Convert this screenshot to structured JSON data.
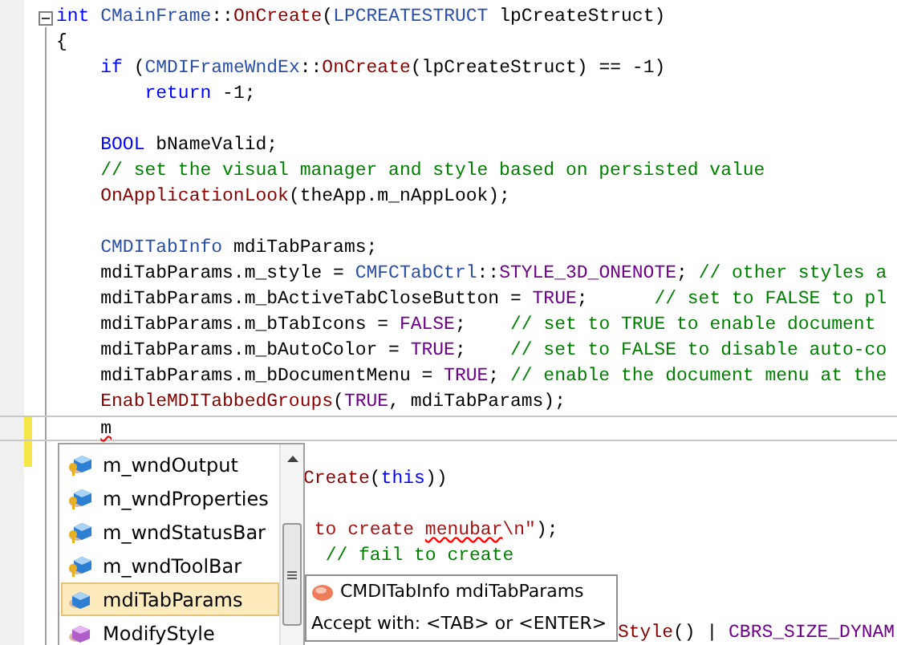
{
  "editor": {
    "lines": [
      {
        "kind": "line",
        "changed": false,
        "current": false,
        "collapsible": true,
        "tokens": [
          {
            "kind": "keyword",
            "text": "int"
          },
          {
            "kind": "type",
            "text": " CMainFrame"
          },
          {
            "kind": "plain",
            "text": "::"
          },
          {
            "kind": "function",
            "text": "OnCreate"
          },
          {
            "kind": "plain",
            "text": "("
          },
          {
            "kind": "type",
            "text": "LPCREATESTRUCT"
          },
          {
            "kind": "plain",
            "text": " lpCreateStruct)"
          }
        ]
      },
      {
        "kind": "line",
        "changed": false,
        "current": false,
        "collapsible": false,
        "tokens": [
          {
            "kind": "plain",
            "text": "{"
          }
        ]
      },
      {
        "kind": "line",
        "changed": false,
        "current": false,
        "collapsible": false,
        "tokens": [
          {
            "kind": "keyword",
            "text": "    if"
          },
          {
            "kind": "plain",
            "text": " ("
          },
          {
            "kind": "type",
            "text": "CMDIFrameWndEx"
          },
          {
            "kind": "plain",
            "text": "::"
          },
          {
            "kind": "function",
            "text": "OnCreate"
          },
          {
            "kind": "plain",
            "text": "(lpCreateStruct) == -1)"
          }
        ]
      },
      {
        "kind": "line",
        "changed": false,
        "current": false,
        "collapsible": false,
        "tokens": [
          {
            "kind": "keyword",
            "text": "        return"
          },
          {
            "kind": "plain",
            "text": " -1;"
          }
        ]
      },
      {
        "kind": "line",
        "changed": false,
        "current": false,
        "collapsible": false
      },
      {
        "kind": "line",
        "changed": false,
        "current": false,
        "collapsible": false,
        "tokens": [
          {
            "kind": "keyword",
            "text": "    BOOL"
          },
          {
            "kind": "plain",
            "text": " bNameValid;"
          }
        ]
      },
      {
        "kind": "line",
        "changed": false,
        "current": false,
        "collapsible": false,
        "tokens": [
          {
            "kind": "comment",
            "text": "    // set the visual manager and style based on persisted value"
          }
        ]
      },
      {
        "kind": "line",
        "changed": false,
        "current": false,
        "collapsible": false,
        "tokens": [
          {
            "kind": "function",
            "text": "    OnApplicationLook"
          },
          {
            "kind": "plain",
            "text": "(theApp.m_nAppLook);"
          }
        ]
      },
      {
        "kind": "line",
        "changed": false,
        "current": false,
        "collapsible": false
      },
      {
        "kind": "line",
        "changed": false,
        "current": false,
        "collapsible": false,
        "tokens": [
          {
            "kind": "type",
            "text": "    CMDITabInfo"
          },
          {
            "kind": "plain",
            "text": " mdiTabParams;"
          }
        ]
      },
      {
        "kind": "line",
        "changed": false,
        "current": false,
        "collapsible": false,
        "tokens": [
          {
            "kind": "plain",
            "text": "    mdiTabParams.m_style = "
          },
          {
            "kind": "type",
            "text": "CMFCTabCtrl"
          },
          {
            "kind": "plain",
            "text": "::"
          },
          {
            "kind": "macro",
            "text": "STYLE_3D_ONENOTE"
          },
          {
            "kind": "plain",
            "text": "; "
          },
          {
            "kind": "comment",
            "text": "// other styles a"
          }
        ]
      },
      {
        "kind": "line",
        "changed": false,
        "current": false,
        "collapsible": false,
        "tokens": [
          {
            "kind": "plain",
            "text": "    mdiTabParams.m_bActiveTabCloseButton = "
          },
          {
            "kind": "macro",
            "text": "TRUE"
          },
          {
            "kind": "plain",
            "text": ";      "
          },
          {
            "kind": "comment",
            "text": "// set to FALSE to pl"
          }
        ]
      },
      {
        "kind": "line",
        "changed": false,
        "current": false,
        "collapsible": false,
        "tokens": [
          {
            "kind": "plain",
            "text": "    mdiTabParams.m_bTabIcons = "
          },
          {
            "kind": "macro",
            "text": "FALSE"
          },
          {
            "kind": "plain",
            "text": ";    "
          },
          {
            "kind": "comment",
            "text": "// set to TRUE to enable document"
          }
        ]
      },
      {
        "kind": "line",
        "changed": false,
        "current": false,
        "collapsible": false,
        "tokens": [
          {
            "kind": "plain",
            "text": "    mdiTabParams.m_bAutoColor = "
          },
          {
            "kind": "macro",
            "text": "TRUE"
          },
          {
            "kind": "plain",
            "text": ";    "
          },
          {
            "kind": "comment",
            "text": "// set to FALSE to disable auto-co"
          }
        ]
      },
      {
        "kind": "line",
        "changed": false,
        "current": false,
        "collapsible": false,
        "tokens": [
          {
            "kind": "plain",
            "text": "    mdiTabParams.m_bDocumentMenu = "
          },
          {
            "kind": "macro",
            "text": "TRUE"
          },
          {
            "kind": "plain",
            "text": "; "
          },
          {
            "kind": "comment",
            "text": "// enable the document menu at the"
          }
        ]
      },
      {
        "kind": "line",
        "changed": false,
        "current": false,
        "collapsible": false,
        "tokens": [
          {
            "kind": "function",
            "text": "    EnableMDITabbedGroups"
          },
          {
            "kind": "plain",
            "text": "("
          },
          {
            "kind": "macro",
            "text": "TRUE"
          },
          {
            "kind": "plain",
            "text": ", mdiTabParams);"
          }
        ]
      },
      {
        "kind": "line",
        "changed": true,
        "current": true,
        "collapsible": false,
        "tokens": [
          {
            "kind": "error",
            "text": "    m"
          }
        ]
      },
      {
        "kind": "line",
        "changed": true,
        "current": false,
        "collapsible": false
      },
      {
        "kind": "after_list",
        "changed": false,
        "current": false,
        "collapsible": false,
        "tokens": [
          {
            "kind": "function",
            "text": "Create"
          },
          {
            "kind": "plain",
            "text": "("
          },
          {
            "kind": "keyword",
            "text": "this"
          },
          {
            "kind": "plain",
            "text": "))"
          }
        ]
      },
      {
        "kind": "line",
        "changed": false,
        "current": false,
        "collapsible": false
      },
      {
        "kind": "after_list",
        "changed": false,
        "current": false,
        "collapsible": false,
        "tokens": [
          {
            "kind": "string",
            "text": " to create "
          },
          {
            "kind": "string_error",
            "text": "menubar"
          },
          {
            "kind": "string",
            "text": "\\n\""
          },
          {
            "kind": "plain",
            "text": ");"
          }
        ]
      },
      {
        "kind": "after_list",
        "changed": false,
        "current": false,
        "collapsible": false,
        "tokens": [
          {
            "kind": "comment",
            "text": "  // fail to create"
          }
        ]
      },
      {
        "kind": "line",
        "changed": false,
        "current": false,
        "collapsible": false
      },
      {
        "kind": "line",
        "changed": false,
        "current": false,
        "collapsible": false
      },
      {
        "kind": "after_tip",
        "changed": false,
        "current": false,
        "collapsible": false,
        "tokens": [
          {
            "kind": "function",
            "text": "Style"
          },
          {
            "kind": "plain",
            "text": "() | "
          },
          {
            "kind": "macro",
            "text": "CBRS_SIZE_DYNAM"
          }
        ]
      }
    ]
  },
  "completion": {
    "items": [
      {
        "label": "m_wndOutput",
        "kind": "protected_field",
        "selected": false
      },
      {
        "label": "m_wndProperties",
        "kind": "protected_field",
        "selected": false
      },
      {
        "label": "m_wndStatusBar",
        "kind": "protected_field",
        "selected": false
      },
      {
        "label": "m_wndToolBar",
        "kind": "protected_field",
        "selected": false
      },
      {
        "label": "mdiTabParams",
        "kind": "field",
        "selected": true
      },
      {
        "label": "ModifyStyle",
        "kind": "method",
        "selected": false
      }
    ],
    "tooltip": {
      "signature": "CMDITabInfo mdiTabParams",
      "hint": "Accept with: <TAB> or <ENTER>"
    }
  }
}
